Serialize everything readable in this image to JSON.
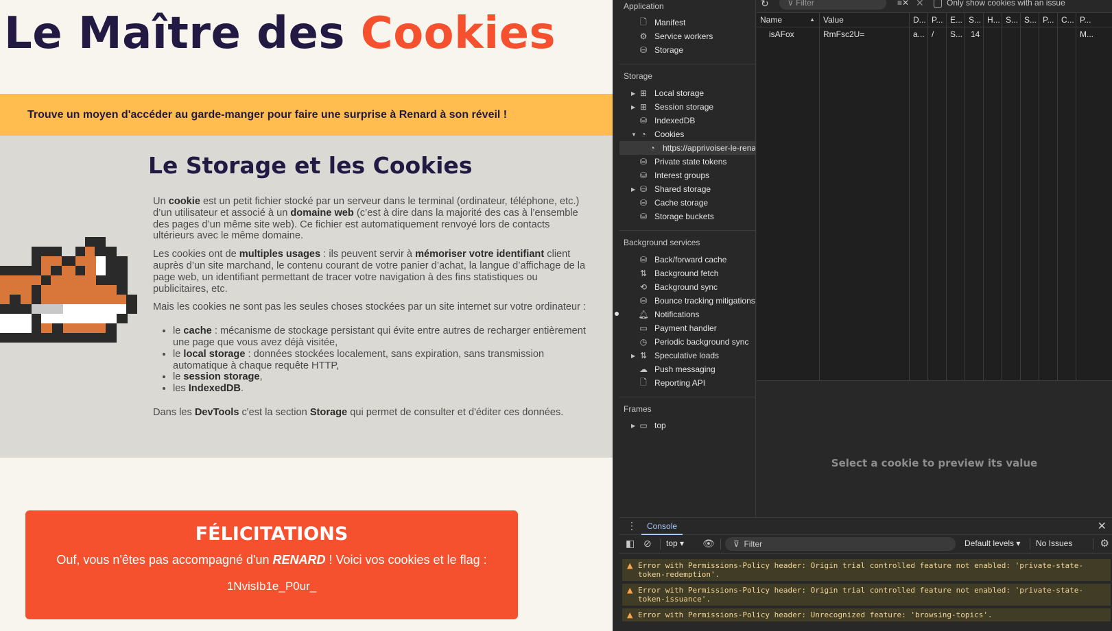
{
  "page": {
    "title_main": "Le Maître des ",
    "title_accent": "Cookies",
    "banner": "Trouve un moyen d'accéder au garde-manger pour faire une surprise à Renard à son réveil !",
    "section_title": "Le Storage et les Cookies",
    "p1": {
      "a": "Un ",
      "b": "cookie",
      "c": " est un petit fichier stocké par un serveur dans le terminal (ordinateur, téléphone, etc.) d’un utilisateur et associé à un ",
      "d": "domaine web",
      "e": " (c’est à dire dans la majorité des cas à l’ensemble des pages d’un même site web). Ce fichier est automatiquement renvoyé lors de contacts ultérieurs avec le même domaine."
    },
    "p2": {
      "a": "Les cookies ont de ",
      "b": "multiples usages",
      "c": " : ils peuvent servir à ",
      "d": "mémoriser votre identifiant",
      "e": " client auprès d’un site marchand, le contenu courant de votre panier d’achat, la langue d’affichage de la page web, un identifiant permettant de tracer votre navigation à des fins statistiques ou publicitaires, etc."
    },
    "p3": "Mais les cookies ne sont pas les seules choses stockées par un site internet sur votre ordinateur :",
    "list": [
      {
        "pre": "le ",
        "bold": "cache",
        "post": " : mécanisme de stockage persistant qui évite entre autres de recharger entièrement une page que vous avez déjà visitée,"
      },
      {
        "pre": "le ",
        "bold": "local storage",
        "post": " : données stockées localement, sans expiration, sans transmission automatique à chaque requête HTTP,"
      },
      {
        "pre": "le ",
        "bold": "session storage",
        "post": ","
      },
      {
        "pre": "les ",
        "bold": "IndexedDB",
        "post": "."
      }
    ],
    "p4": {
      "a": "Dans les ",
      "b": "DevTools",
      "c": " c'est la section ",
      "d": "Storage",
      "e": " qui permet de consulter et d'éditer ces données."
    },
    "congrats": {
      "title": "FÉLICITATIONS",
      "msg_a": "Ouf, vous n'êtes pas accompagné d'un ",
      "msg_b": "RENARD",
      "msg_c": " ! Voici vos cookies et le flag :",
      "flag": "1NvisIb1e_P0ur_"
    }
  },
  "devtools": {
    "sidebar": {
      "application_title": "Application",
      "application_items": [
        {
          "label": "Manifest",
          "icon": "file-icon"
        },
        {
          "label": "Service workers",
          "icon": "gears-icon"
        },
        {
          "label": "Storage",
          "icon": "database-icon"
        }
      ],
      "storage_title": "Storage",
      "storage_items": [
        {
          "label": "Local storage",
          "icon": "grid-icon"
        },
        {
          "label": "Session storage",
          "icon": "grid-icon"
        },
        {
          "label": "IndexedDB",
          "icon": "database-icon"
        },
        {
          "label": "Cookies",
          "icon": "cookie-icon"
        },
        {
          "label": "https://apprivoiser-le-rena",
          "icon": "cookie-icon"
        },
        {
          "label": "Private state tokens",
          "icon": "database-icon"
        },
        {
          "label": "Interest groups",
          "icon": "database-icon"
        },
        {
          "label": "Shared storage",
          "icon": "database-icon"
        },
        {
          "label": "Cache storage",
          "icon": "database-icon"
        },
        {
          "label": "Storage buckets",
          "icon": "database-icon"
        }
      ],
      "background_title": "Background services",
      "background_items": [
        {
          "label": "Back/forward cache",
          "icon": "database-icon"
        },
        {
          "label": "Background fetch",
          "icon": "arrows-icon"
        },
        {
          "label": "Background sync",
          "icon": "sync-icon"
        },
        {
          "label": "Bounce tracking mitigations",
          "icon": "database-icon"
        },
        {
          "label": "Notifications",
          "icon": "bell-icon"
        },
        {
          "label": "Payment handler",
          "icon": "card-icon"
        },
        {
          "label": "Periodic background sync",
          "icon": "clock-icon"
        },
        {
          "label": "Speculative loads",
          "icon": "arrows-icon"
        },
        {
          "label": "Push messaging",
          "icon": "cloud-icon"
        },
        {
          "label": "Reporting API",
          "icon": "file-icon"
        }
      ],
      "frames_title": "Frames",
      "frames_items": [
        {
          "label": "top",
          "icon": "frame-icon"
        }
      ]
    },
    "toolbar": {
      "filter_placeholder": "Filter",
      "only_issues_label": "Only show cookies with an issue"
    },
    "table": {
      "headers": [
        "Name",
        "Value",
        "D...",
        "P...",
        "E...",
        "S...",
        "H...",
        "S...",
        "S...",
        "P...",
        "C...",
        "P..."
      ],
      "rows": [
        [
          "isAFox",
          "RmFsc2U=",
          "a...",
          "/",
          "S...",
          "14",
          "",
          "",
          "",
          "",
          "",
          "M..."
        ]
      ]
    },
    "preview_empty": "Select a cookie to preview its value",
    "console": {
      "tab_label": "Console",
      "context": "top",
      "filter_placeholder": "Filter",
      "levels": "Default levels",
      "issues": "No Issues",
      "messages": [
        "Error with Permissions-Policy header: Origin trial controlled feature not enabled: 'private-state-token-redemption'.",
        "Error with Permissions-Policy header: Origin trial controlled feature not enabled: 'private-state-token-issuance'.",
        "Error with Permissions-Policy header: Unrecognized feature: 'browsing-topics'."
      ]
    }
  },
  "colors": {
    "title_dark": "#231a44",
    "accent_orange": "#f5512e",
    "banner_yellow": "#ffbc4f",
    "section_gray": "#dad9d4",
    "devtools_bg": "#282828",
    "warning_bg": "#413c26"
  }
}
